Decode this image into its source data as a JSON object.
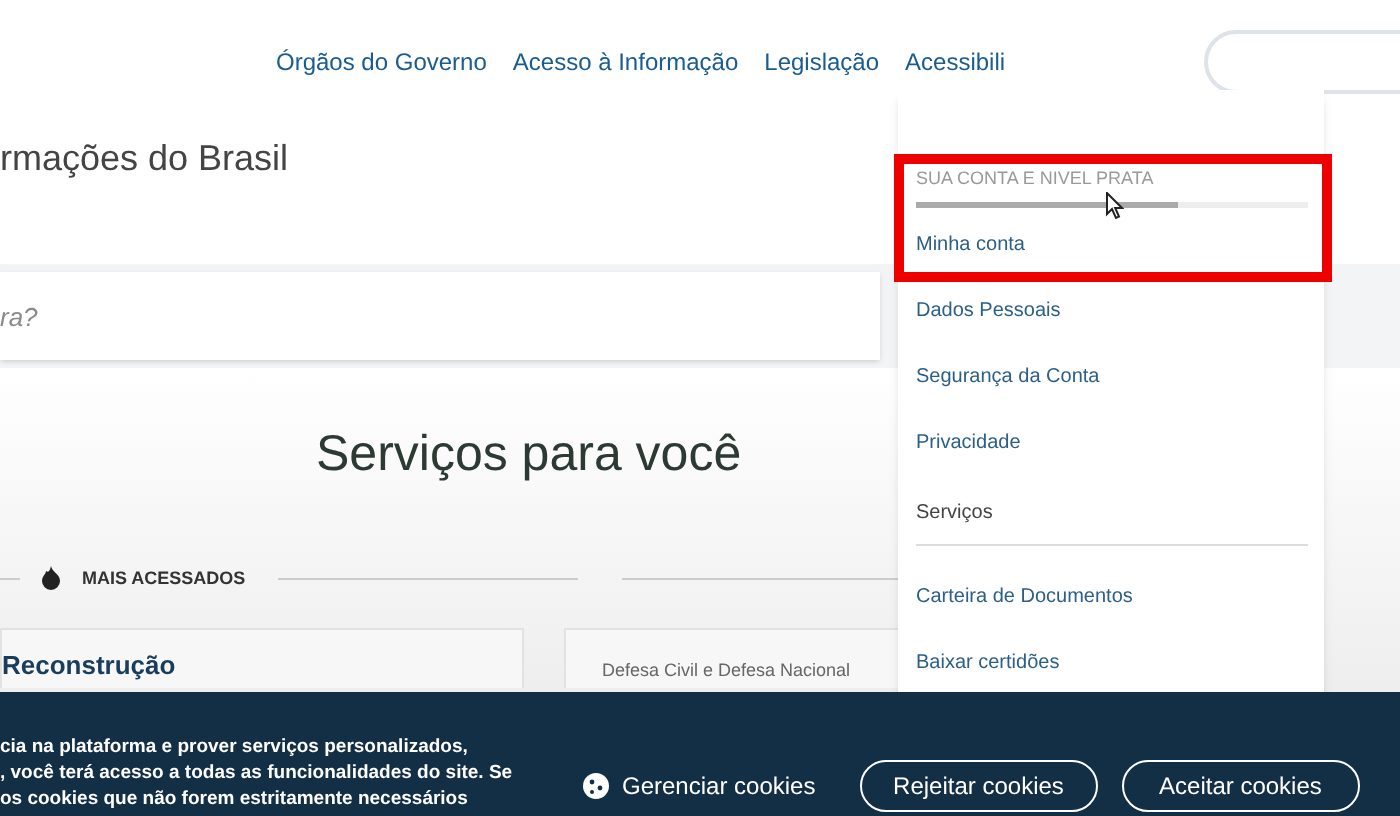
{
  "nav": {
    "links": [
      "Órgãos do Governo",
      "Acesso à Informação",
      "Legislação",
      "Acessibili"
    ]
  },
  "page_title": "rmações do Brasil",
  "search": {
    "placeholder": "ra?"
  },
  "section_title": "Serviços para você",
  "filter": {
    "label": "MAIS ACESSADOS"
  },
  "cards": [
    {
      "title": "Reconstrução"
    },
    {
      "category": "Defesa Civil e Defesa Nacional"
    }
  ],
  "account_menu": {
    "header": "SUA CONTA E NIVEL PRATA",
    "level": 0.67,
    "items": [
      {
        "kind": "link",
        "label": "Minha conta"
      },
      {
        "kind": "link",
        "label": "Dados Pessoais"
      },
      {
        "kind": "link",
        "label": "Segurança da Conta"
      },
      {
        "kind": "link",
        "label": "Privacidade"
      },
      {
        "kind": "section",
        "label": "Serviços"
      },
      {
        "kind": "link",
        "label": "Carteira de Documentos"
      },
      {
        "kind": "link",
        "label": "Baixar certidões"
      }
    ]
  },
  "cookie_banner": {
    "lines": [
      "cia na plataforma e prover serviços personalizados,",
      ", você terá acesso a todas as funcionalidades do site. Se",
      "os cookies que não forem estritamente necessários"
    ],
    "buttons": [
      {
        "kind": "plain",
        "label": "Gerenciar cookies"
      },
      {
        "kind": "outline",
        "label": "Rejeitar cookies"
      },
      {
        "kind": "outline",
        "label": "Aceitar cookies"
      }
    ]
  }
}
